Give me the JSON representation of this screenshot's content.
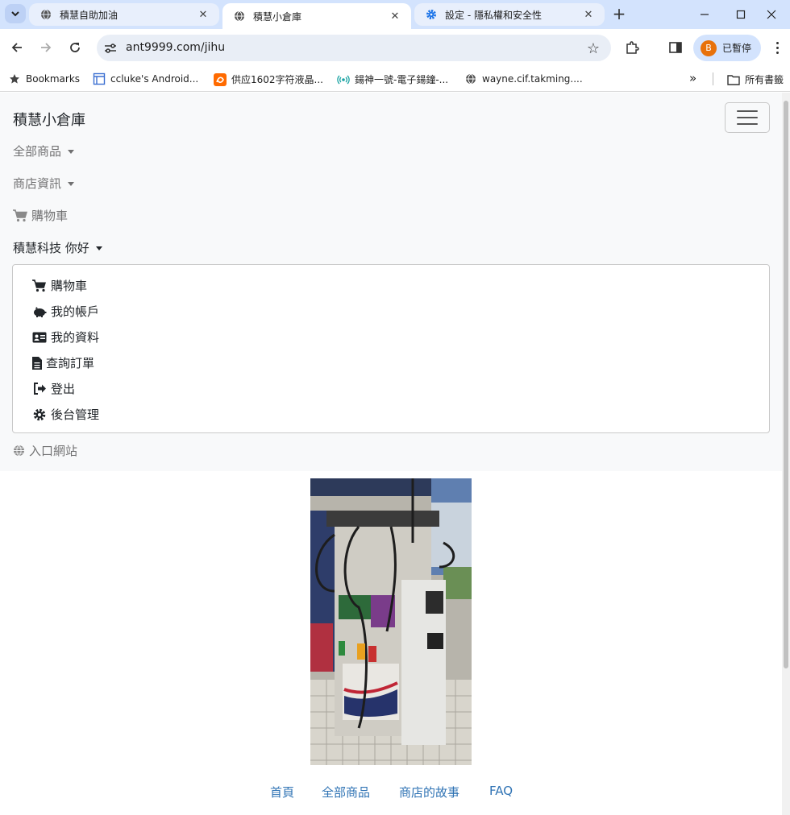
{
  "browser": {
    "tabs": [
      {
        "title": "積慧自助加油",
        "active": false
      },
      {
        "title": "積慧小倉庫",
        "active": true
      },
      {
        "title": "設定 - 隱私權和安全性",
        "active": false
      }
    ],
    "url": "ant9999.com/jihu",
    "profile": {
      "initial": "B",
      "status": "已暫停"
    },
    "bookmarks": [
      {
        "label": "Bookmarks",
        "icon": "star-icon"
      },
      {
        "label": "ccluke's Android...",
        "icon": "page-icon"
      },
      {
        "label": "供应1602字符液晶...",
        "icon": "alibaba-icon"
      },
      {
        "label": "鍚神一號-電子鍚鐘-...",
        "icon": "radio-icon"
      },
      {
        "label": "wayne.cif.takming....",
        "icon": "globe-icon"
      }
    ],
    "all_bookmarks_label": "所有書籤",
    "more_label": "»"
  },
  "navbar": {
    "brand": "積慧小倉庫",
    "links": {
      "all_products": "全部商品",
      "store_info": "商店資訊",
      "cart": "購物車",
      "user_greeting": "積慧科技 你好"
    },
    "user_menu": [
      {
        "label": "購物車",
        "icon": "cart-icon"
      },
      {
        "label": "我的帳戶",
        "icon": "piggy-bank-icon"
      },
      {
        "label": "我的資料",
        "icon": "id-card-icon"
      },
      {
        "label": "查詢訂單",
        "icon": "file-icon"
      },
      {
        "label": "登出",
        "icon": "sign-out-icon"
      },
      {
        "label": "後台管理",
        "icon": "cog-icon"
      }
    ],
    "portal": "入口網站"
  },
  "footer": {
    "links": [
      "首頁",
      "全部商品",
      "商店的故事",
      "FAQ"
    ]
  },
  "colors": {
    "link": "#2f73b4",
    "tabstrip": "#d3e3fd",
    "navbar_bg": "#f8f9fa"
  }
}
